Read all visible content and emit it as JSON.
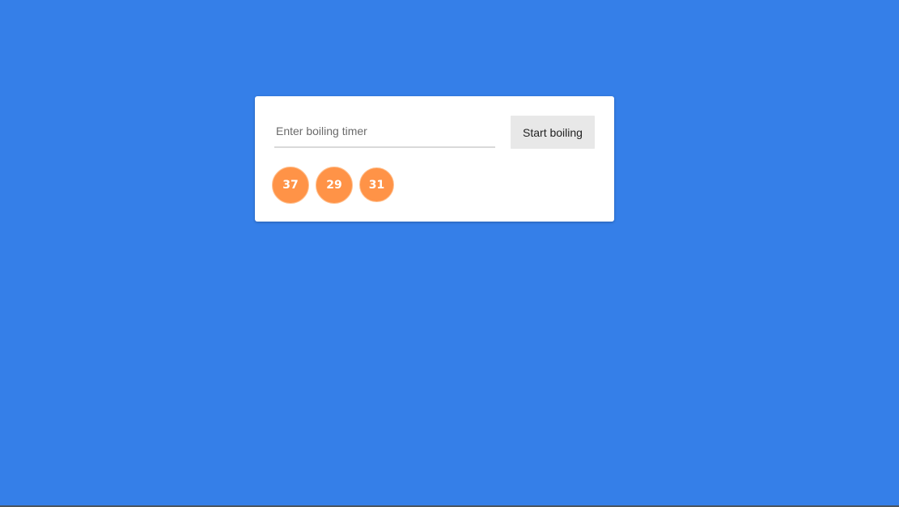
{
  "colors": {
    "background": "#357fe8",
    "card": "#ffffff",
    "timer_badge": "#ff9347",
    "button_bg": "#e8e8e8"
  },
  "timer_form": {
    "input_placeholder": "Enter boiling timer",
    "input_value": "",
    "start_button_label": "Start boiling"
  },
  "timers": [
    {
      "value": "37"
    },
    {
      "value": "29"
    },
    {
      "value": "31"
    }
  ]
}
